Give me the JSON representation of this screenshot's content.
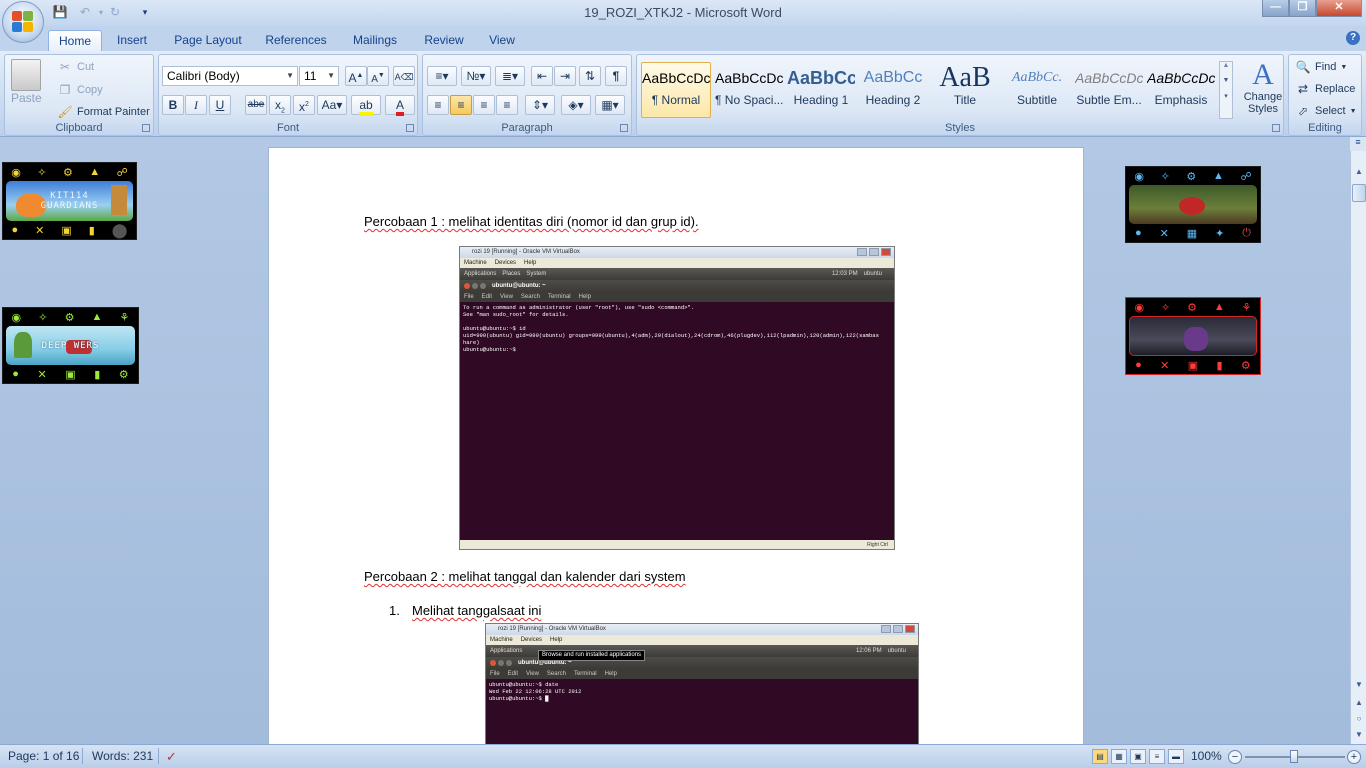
{
  "window": {
    "title": "19_ROZI_XTKJ2 - Microsoft Word"
  },
  "tabs": [
    "Home",
    "Insert",
    "Page Layout",
    "References",
    "Mailings",
    "Review",
    "View"
  ],
  "ribbon": {
    "clipboard": {
      "label": "Clipboard",
      "paste": "Paste",
      "cut": "Cut",
      "copy": "Copy",
      "format_painter": "Format Painter"
    },
    "font": {
      "label": "Font",
      "font_name": "Calibri (Body)",
      "font_size": "11"
    },
    "paragraph": {
      "label": "Paragraph"
    },
    "styles": {
      "label": "Styles",
      "items": [
        {
          "sample": "AaBbCcDc",
          "name": "¶ Normal"
        },
        {
          "sample": "AaBbCcDc",
          "name": "¶ No Spaci..."
        },
        {
          "sample": "AaBbCc",
          "name": "Heading 1"
        },
        {
          "sample": "AaBbCc",
          "name": "Heading 2"
        },
        {
          "sample": "AaB",
          "name": "Title"
        },
        {
          "sample": "AaBbCc.",
          "name": "Subtitle"
        },
        {
          "sample": "AaBbCcDc",
          "name": "Subtle Em..."
        },
        {
          "sample": "AaBbCcDc",
          "name": "Emphasis"
        }
      ],
      "change_styles": "Change Styles"
    },
    "editing": {
      "label": "Editing",
      "find": "Find",
      "replace": "Replace",
      "select": "Select"
    }
  },
  "document": {
    "p1": "Percobaan 1 : melihat identitas diri (nomor id dan grup id).",
    "p2": "Percobaan 2 : melihat tanggal dan kalender dari system",
    "list_number": "1.",
    "list_item": "Melihat tanggalsaat ini",
    "shot1": {
      "vm_title": "rozi 19 [Running] - Oracle VM VirtualBox",
      "vm_menu": [
        "Machine",
        "Devices",
        "Help"
      ],
      "panel": [
        "Applications",
        "Places",
        "System"
      ],
      "clock": "12:03 PM",
      "user": "ubuntu",
      "term_title": "ubuntu@ubuntu: ~",
      "term_menu": [
        "File",
        "Edit",
        "View",
        "Search",
        "Terminal",
        "Help"
      ],
      "terminal": "To run a command as administrator (user \"root\"), use \"sudo <command>\".\nSee \"man sudo_root\" for details.\n\nubuntu@ubuntu:~$ id\nuid=999(ubuntu) gid=999(ubuntu) groups=999(ubuntu),4(adm),20(dialout),24(cdrom),46(plugdev),112(lpadmin),120(admin),122(sambas\nhare)\nubuntu@ubuntu:~$",
      "status": "Right Ctrl"
    },
    "shot2": {
      "vm_title": "rozi 19 [Running] - Oracle VM VirtualBox",
      "vm_menu": [
        "Machine",
        "Devices",
        "Help"
      ],
      "panel": [
        "Applications"
      ],
      "tooltip": "Browse and run installed applications",
      "clock": "12:06 PM",
      "user": "ubuntu",
      "term_title": "ubuntu@ubuntu: ~",
      "term_menu": [
        "File",
        "Edit",
        "View",
        "Search",
        "Terminal",
        "Help"
      ],
      "terminal": "ubuntu@ubuntu:~$ date\nWed Feb 22 12:06:28 UTC 2012\nubuntu@ubuntu:~$ █"
    }
  },
  "widgets": {
    "w1_text": "KIT114\nGUARDIANS",
    "w2_text": "DEEP    WERS"
  },
  "statusbar": {
    "page": "Page: 1 of 16",
    "words": "Words: 231",
    "zoom": "100%"
  },
  "colors": {
    "accent": "#15428b",
    "terminal_bg": "#300a24",
    "ribbon_bg": "#dce7f5"
  }
}
